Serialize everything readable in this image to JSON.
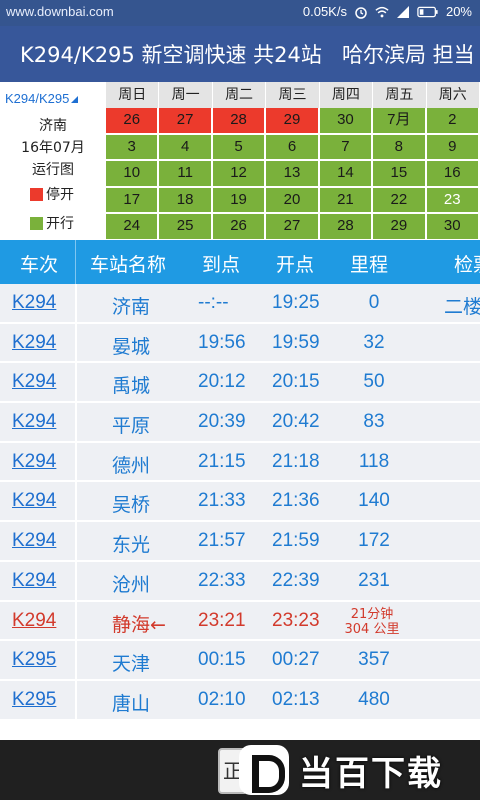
{
  "status_bar": {
    "watermark": "www.downbai.com",
    "speed": "0.05K/s",
    "battery": "20%",
    "icons": [
      "alarm-icon",
      "wifi-icon",
      "signal-icon",
      "battery-icon"
    ]
  },
  "title_bar": {
    "title": "K294/K295 新空调快速 共24站",
    "bureau": "哈尔滨局 担当"
  },
  "calendar": {
    "train_selector": "K294/K295",
    "station": "济南",
    "month": "16年07月",
    "chart_label": "运行图",
    "legend": [
      {
        "label": "停开",
        "color": "#ec3a2c"
      },
      {
        "label": "开行",
        "color": "#7ab13b"
      }
    ],
    "weekdays": [
      "周日",
      "周一",
      "周二",
      "周三",
      "周四",
      "周五",
      "周六"
    ],
    "weeks": [
      [
        {
          "d": "26",
          "s": "stop"
        },
        {
          "d": "27",
          "s": "stop"
        },
        {
          "d": "28",
          "s": "stop"
        },
        {
          "d": "29",
          "s": "stop"
        },
        {
          "d": "30",
          "s": "run"
        },
        {
          "d": "7月",
          "s": "run"
        },
        {
          "d": "2",
          "s": "run"
        }
      ],
      [
        {
          "d": "3",
          "s": "run"
        },
        {
          "d": "4",
          "s": "run"
        },
        {
          "d": "5",
          "s": "run"
        },
        {
          "d": "6",
          "s": "run"
        },
        {
          "d": "7",
          "s": "run"
        },
        {
          "d": "8",
          "s": "run"
        },
        {
          "d": "9",
          "s": "run"
        }
      ],
      [
        {
          "d": "10",
          "s": "run"
        },
        {
          "d": "11",
          "s": "run"
        },
        {
          "d": "12",
          "s": "run"
        },
        {
          "d": "13",
          "s": "run"
        },
        {
          "d": "14",
          "s": "run"
        },
        {
          "d": "15",
          "s": "run"
        },
        {
          "d": "16",
          "s": "run"
        }
      ],
      [
        {
          "d": "17",
          "s": "run"
        },
        {
          "d": "18",
          "s": "run"
        },
        {
          "d": "19",
          "s": "run"
        },
        {
          "d": "20",
          "s": "run"
        },
        {
          "d": "21",
          "s": "run"
        },
        {
          "d": "22",
          "s": "run"
        },
        {
          "d": "23",
          "s": "run",
          "today": true
        }
      ],
      [
        {
          "d": "24",
          "s": "run"
        },
        {
          "d": "25",
          "s": "run"
        },
        {
          "d": "26",
          "s": "run"
        },
        {
          "d": "27",
          "s": "run"
        },
        {
          "d": "28",
          "s": "run"
        },
        {
          "d": "29",
          "s": "run"
        },
        {
          "d": "30",
          "s": "run"
        }
      ]
    ]
  },
  "table": {
    "headers": {
      "train": "车次",
      "station": "车站名称",
      "arrive": "到点",
      "depart": "开点",
      "distance": "里程",
      "check": "检票"
    },
    "rows": [
      {
        "train": "K294",
        "station": "济南",
        "arrive": "--:--",
        "depart": "19:25",
        "distance": "0",
        "more": "二楼"
      },
      {
        "train": "K294",
        "station": "晏城",
        "arrive": "19:56",
        "depart": "19:59",
        "distance": "32",
        "more": ""
      },
      {
        "train": "K294",
        "station": "禹城",
        "arrive": "20:12",
        "depart": "20:15",
        "distance": "50",
        "more": ""
      },
      {
        "train": "K294",
        "station": "平原",
        "arrive": "20:39",
        "depart": "20:42",
        "distance": "83",
        "more": ""
      },
      {
        "train": "K294",
        "station": "德州",
        "arrive": "21:15",
        "depart": "21:18",
        "distance": "118",
        "more": ""
      },
      {
        "train": "K294",
        "station": "吴桥",
        "arrive": "21:33",
        "depart": "21:36",
        "distance": "140",
        "more": ""
      },
      {
        "train": "K294",
        "station": "东光",
        "arrive": "21:57",
        "depart": "21:59",
        "distance": "172",
        "more": ""
      },
      {
        "train": "K294",
        "station": "沧州",
        "arrive": "22:33",
        "depart": "22:39",
        "distance": "231",
        "more": ""
      },
      {
        "train": "K294",
        "station": "静海←",
        "arrive": "23:21",
        "depart": "23:23",
        "distance": "",
        "interval_time": "21分钟",
        "interval_dist": "304 公里",
        "current": true,
        "more": ""
      },
      {
        "train": "K295",
        "station": "天津",
        "arrive": "00:15",
        "depart": "00:27",
        "distance": "357",
        "more": ""
      },
      {
        "train": "K295",
        "station": "唐山",
        "arrive": "02:10",
        "depart": "02:13",
        "distance": "480",
        "more": ""
      }
    ]
  },
  "bottom": {
    "button_label": "正",
    "logo_text": "当百下载"
  }
}
